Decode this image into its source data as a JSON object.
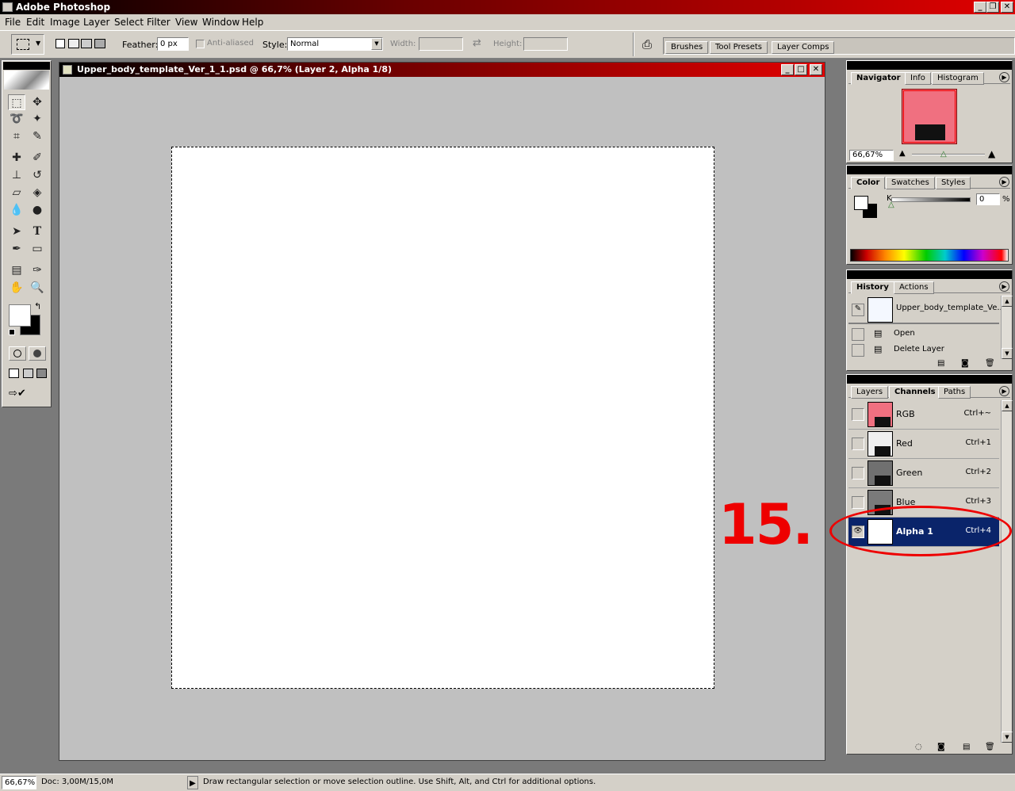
{
  "app": {
    "title": "Adobe Photoshop"
  },
  "menu": [
    "File",
    "Edit",
    "Image",
    "Layer",
    "Select",
    "Filter",
    "View",
    "Window",
    "Help"
  ],
  "options": {
    "feather_label": "Feather:",
    "feather_value": "0 px",
    "anti_aliased": "Anti-aliased",
    "style_label": "Style:",
    "style_value": "Normal",
    "width_label": "Width:",
    "height_label": "Height:",
    "well_tabs": [
      "Brushes",
      "Tool Presets",
      "Layer Comps"
    ]
  },
  "document": {
    "title": "Upper_body_template_Ver_1_1.psd @ 66,7% (Layer 2, Alpha 1/8)"
  },
  "navigator": {
    "tabs": [
      "Navigator",
      "Info",
      "Histogram"
    ],
    "zoom": "66,67%"
  },
  "color": {
    "tabs": [
      "Color",
      "Swatches",
      "Styles"
    ],
    "slider_label": "K",
    "value": "0",
    "unit": "%",
    "k_level": 0
  },
  "history": {
    "tabs": [
      "History",
      "Actions"
    ],
    "snapshot": "Upper_body_template_Ve...",
    "items": [
      "Open",
      "Delete Layer"
    ]
  },
  "channels": {
    "tabs": [
      "Layers",
      "Channels",
      "Paths"
    ],
    "rows": [
      {
        "name": "RGB",
        "shortcut": "Ctrl+~"
      },
      {
        "name": "Red",
        "shortcut": "Ctrl+1"
      },
      {
        "name": "Green",
        "shortcut": "Ctrl+2"
      },
      {
        "name": "Blue",
        "shortcut": "Ctrl+3"
      },
      {
        "name": "Alpha 1",
        "shortcut": "Ctrl+4"
      }
    ]
  },
  "annotation": {
    "text": "15."
  },
  "status": {
    "zoom": "66,67%",
    "doc": "Doc: 3,00M/15,0M",
    "hint": "Draw rectangular selection or move selection outline.  Use Shift, Alt, and Ctrl for additional options."
  },
  "colors": {
    "annotation_red": "#ee0000",
    "selection_blue": "#0a246a",
    "thumb_pink": "#f07080"
  }
}
